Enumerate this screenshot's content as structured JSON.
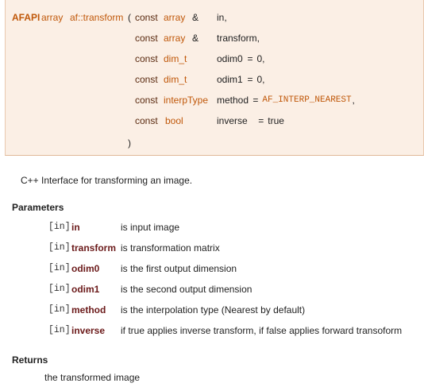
{
  "prototype": {
    "macro": "AFAPI",
    "return_type": "array",
    "func_name": "af::transform",
    "open_paren": "(",
    "close_paren": ")",
    "params": [
      {
        "qualifier": "const",
        "type": "array",
        "ref": "&",
        "name": "in,",
        "default_eq": "",
        "default_val": "",
        "default_val_mono": false,
        "trail": ""
      },
      {
        "qualifier": "const",
        "type": "array",
        "ref": "&",
        "name": "transform,",
        "default_eq": "",
        "default_val": "",
        "default_val_mono": false,
        "trail": ""
      },
      {
        "qualifier": "const",
        "type": "dim_t",
        "ref": "",
        "name": "odim0",
        "default_eq": "=",
        "default_val": "0,",
        "default_val_mono": false,
        "trail": ""
      },
      {
        "qualifier": "const",
        "type": "dim_t",
        "ref": "",
        "name": "odim1",
        "default_eq": "=",
        "default_val": "0,",
        "default_val_mono": false,
        "trail": ""
      },
      {
        "qualifier": "const",
        "type": "interpType",
        "ref": "",
        "name": "method",
        "default_eq": "=",
        "default_val": "AF_INTERP_NEAREST",
        "default_val_mono": true,
        "trail": ","
      },
      {
        "qualifier": "const",
        "type": "bool",
        "ref": "",
        "name": "inverse",
        "default_eq": "=",
        "default_val": "true",
        "default_val_mono": false,
        "trail": ""
      }
    ]
  },
  "brief": "C++ Interface for transforming an image.",
  "parameters_heading": "Parameters",
  "parameters": [
    {
      "dir": "[in]",
      "name": "in",
      "desc": "is input image"
    },
    {
      "dir": "[in]",
      "name": "transform",
      "desc": "is transformation matrix"
    },
    {
      "dir": "[in]",
      "name": "odim0",
      "desc": "is the first output dimension"
    },
    {
      "dir": "[in]",
      "name": "odim1",
      "desc": "is the second output dimension"
    },
    {
      "dir": "[in]",
      "name": "method",
      "desc": "is the interpolation type (Nearest by default)"
    },
    {
      "dir": "[in]",
      "name": "inverse",
      "desc": "if true applies inverse transform, if false applies forward transoform"
    }
  ],
  "returns_heading": "Returns",
  "returns_text": "the transformed image",
  "colors": {
    "proto_bg": "#fbefe5",
    "proto_border": "#e0b898",
    "type_color": "#c0580a",
    "keyword_color": "#5a2a10",
    "param_name_color": "#6b1a1a"
  }
}
